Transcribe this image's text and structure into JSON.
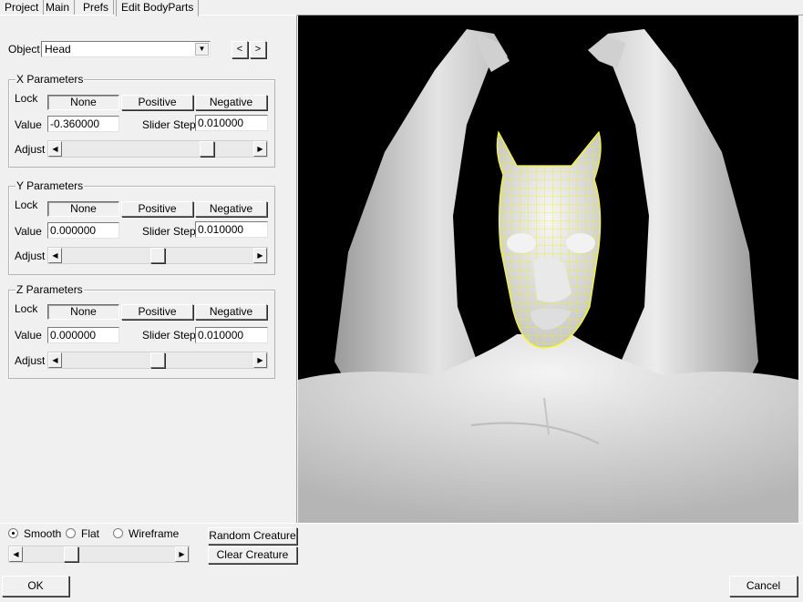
{
  "tabs": [
    {
      "label": "Project"
    },
    {
      "label": "Main"
    },
    {
      "label": "Prefs"
    },
    {
      "label": "Edit BodyParts"
    }
  ],
  "object": {
    "label": "Object",
    "selected": "Head",
    "prev_symbol": "<",
    "next_symbol": ">"
  },
  "x_params": {
    "title": "X Parameters",
    "lock_label": "Lock",
    "lock_options": [
      "None",
      "Positive",
      "Negative"
    ],
    "lock_selected": "None",
    "value_label": "Value",
    "value": "-0.360000",
    "step_label": "Slider Step",
    "step": "0.010000",
    "adjust_label": "Adjust",
    "slider_fraction": 0.78
  },
  "y_params": {
    "title": "Y Parameters",
    "lock_label": "Lock",
    "lock_options": [
      "None",
      "Positive",
      "Negative"
    ],
    "lock_selected": "None",
    "value_label": "Value",
    "value": "0.000000",
    "step_label": "Slider Step",
    "step": "0.010000",
    "adjust_label": "Adjust",
    "slider_fraction": 0.5
  },
  "z_params": {
    "title": "Z Parameters",
    "lock_label": "Lock",
    "lock_options": [
      "None",
      "Positive",
      "Negative"
    ],
    "lock_selected": "None",
    "value_label": "Value",
    "value": "0.000000",
    "step_label": "Slider Step",
    "step": "0.010000",
    "adjust_label": "Adjust",
    "slider_fraction": 0.5
  },
  "render_mode": {
    "options": [
      "Smooth",
      "Flat",
      "Wireframe"
    ],
    "selected": "Smooth",
    "slider_fraction": 0.3
  },
  "buttons": {
    "random": "Random Creature",
    "clear": "Clear Creature",
    "ok": "OK",
    "cancel": "Cancel"
  },
  "colors": {
    "viewport_bg": "#000000",
    "model": "#e6e6e6",
    "wireframe_highlight": "#ffff00"
  },
  "icons": {
    "dropdown": "triangle-down-icon",
    "slider_left": "triangle-left-icon",
    "slider_right": "triangle-right-icon"
  }
}
